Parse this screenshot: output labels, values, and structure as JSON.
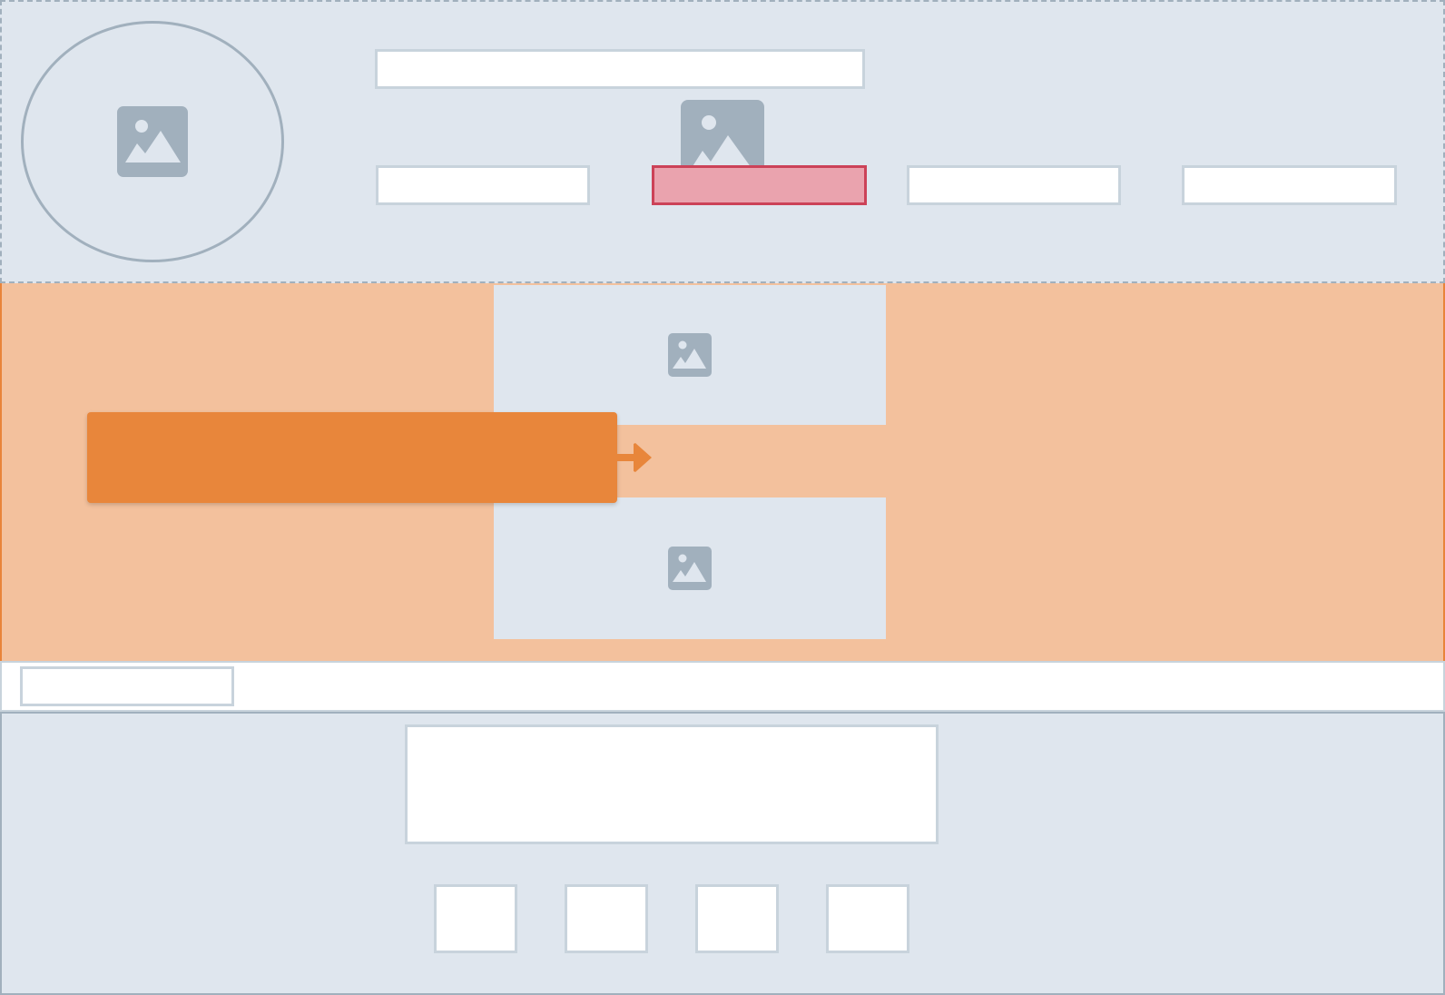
{
  "wireframe": {
    "colors": {
      "section_fill": "#dfe6ee",
      "section_border": "#a1b0bd",
      "placeholder_fill": "#ffffff",
      "placeholder_border": "#c8d3dc",
      "active_fill": "#eaa3ae",
      "active_border": "#cc4258",
      "hero_fill": "#f3c19d",
      "cta_fill": "#e8863b"
    },
    "header": {
      "logo_icon": "image-icon",
      "title_text": "",
      "nav_icon": "image-icon",
      "nav_items": [
        {
          "label": "",
          "state": "default"
        },
        {
          "label": "",
          "state": "active"
        },
        {
          "label": "",
          "state": "default"
        },
        {
          "label": "",
          "state": "default"
        }
      ]
    },
    "hero": {
      "cta_label": "",
      "arrow_icon": "arrow-right-icon",
      "images": [
        "image-icon",
        "image-icon"
      ]
    },
    "strip": {
      "tag_text": ""
    },
    "footer": {
      "text_block": "",
      "thumbnails": [
        "",
        "",
        "",
        ""
      ]
    }
  }
}
